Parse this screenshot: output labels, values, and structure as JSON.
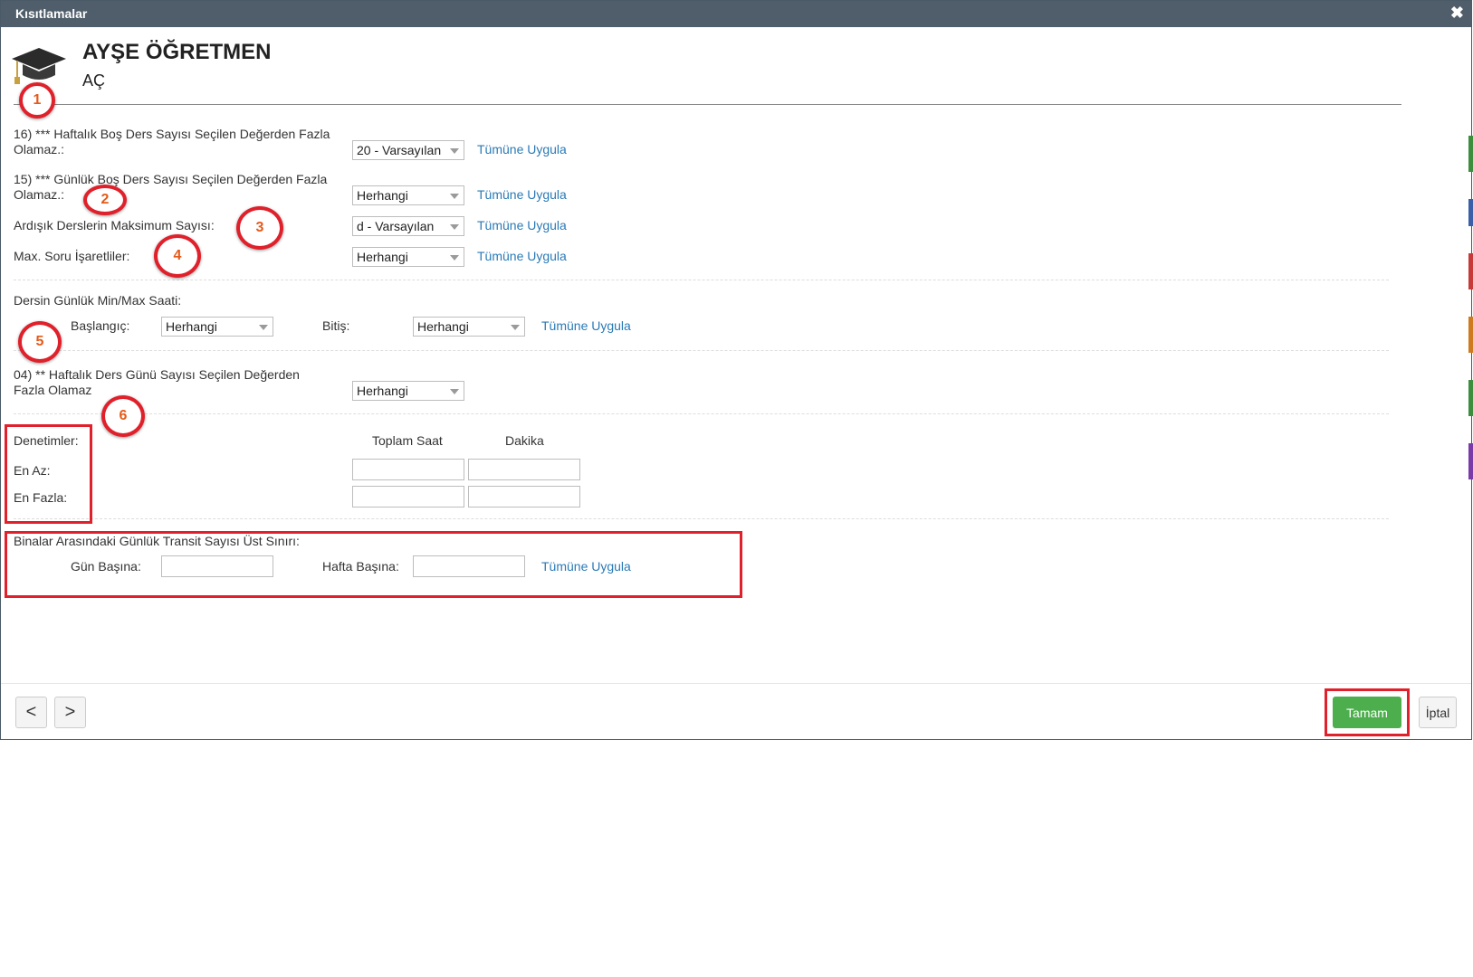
{
  "window": {
    "title": "Kısıtlamalar",
    "close_glyph": "✖"
  },
  "header": {
    "name": "AYŞE ÖĞRETMEN",
    "short": "AÇ",
    "icon": "graduation-cap-icon"
  },
  "rows": {
    "r16": {
      "label": "16) *** Haftalık Boş Ders Sayısı Seçilen Değerden Fazla Olamaz.:",
      "value": "20 - Varsayılan",
      "apply": "Tümüne Uygula"
    },
    "r15": {
      "label": "15) *** Günlük Boş Ders Sayısı Seçilen Değerden Fazla Olamaz.:",
      "value": "Herhangi",
      "apply": "Tümüne Uygula"
    },
    "ardisik": {
      "label": "Ardışık Derslerin Maksimum Sayısı:",
      "value": "d - Varsayılan",
      "apply": "Tümüne Uygula"
    },
    "soru": {
      "label": "Max. Soru İşaretliler:",
      "value": "Herhangi",
      "apply": "Tümüne Uygula"
    }
  },
  "daily_minmax": {
    "label": "Dersin Günlük Min/Max Saati:",
    "start_label": "Başlangıç:",
    "start_value": "Herhangi",
    "end_label": "Bitiş:",
    "end_value": "Herhangi",
    "apply": "Tümüne Uygula"
  },
  "weekly_days": {
    "label": "04) ** Haftalık Ders Günü Sayısı Seçilen Değerden Fazla Olamaz",
    "value": "Herhangi"
  },
  "controls": {
    "label": "Denetimler:",
    "col_hours": "Toplam Saat",
    "col_minutes": "Dakika",
    "min_label": "En Az:",
    "max_label": "En Fazla:",
    "min_hours": "",
    "min_minutes": "",
    "max_hours": "",
    "max_minutes": ""
  },
  "transit": {
    "label": "Binalar Arasındaki Günlük Transit Sayısı Üst Sınırı:",
    "per_day_label": "Gün Başına:",
    "per_day_value": "",
    "per_week_label": "Hafta Başına:",
    "per_week_value": "",
    "apply": "Tümüne Uygula"
  },
  "markers": [
    "1",
    "2",
    "3",
    "4",
    "5",
    "6"
  ],
  "footer": {
    "prev": "<",
    "next": ">",
    "ok": "Tamam",
    "cancel": "İptal"
  },
  "colors": {
    "titlebar": "#4f5e6a",
    "link": "#2a7ab6",
    "ok": "#4cae4c",
    "highlight": "#e0202a"
  }
}
